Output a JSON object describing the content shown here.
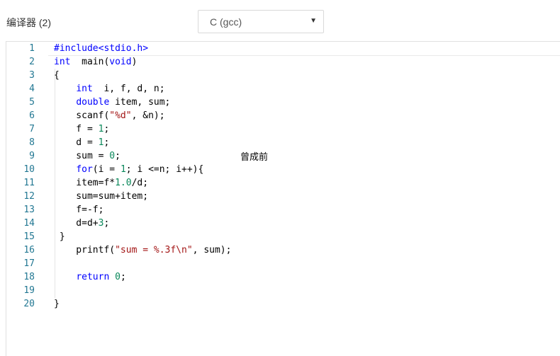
{
  "toolbar": {
    "compiler_label": "编译器 (2)",
    "language_select": {
      "value": "C (gcc)",
      "arrow": "▼"
    }
  },
  "editor": {
    "lines": [
      {
        "n": "1",
        "tokens": [
          [
            "kw",
            "#include<stdio.h>"
          ]
        ]
      },
      {
        "n": "2",
        "tokens": [
          [
            "kw",
            "int"
          ],
          [
            "",
            "  main("
          ],
          [
            "kw",
            "void"
          ],
          [
            "",
            ")"
          ]
        ]
      },
      {
        "n": "3",
        "tokens": [
          [
            "",
            "{"
          ]
        ]
      },
      {
        "n": "4",
        "tokens": [
          [
            "",
            "    "
          ],
          [
            "kw",
            "int"
          ],
          [
            "",
            "  i, f, d, n;"
          ]
        ]
      },
      {
        "n": "5",
        "tokens": [
          [
            "",
            "    "
          ],
          [
            "kw",
            "double"
          ],
          [
            "",
            " item, sum;"
          ]
        ]
      },
      {
        "n": "6",
        "tokens": [
          [
            "",
            "    scanf("
          ],
          [
            "str",
            "\"%d\""
          ],
          [
            "",
            ", &n);"
          ]
        ]
      },
      {
        "n": "7",
        "tokens": [
          [
            "",
            "    f = "
          ],
          [
            "num-lit",
            "1"
          ],
          [
            "",
            ";"
          ]
        ]
      },
      {
        "n": "8",
        "tokens": [
          [
            "",
            "    d = "
          ],
          [
            "num-lit",
            "1"
          ],
          [
            "",
            ";"
          ]
        ]
      },
      {
        "n": "9",
        "tokens": [
          [
            "",
            "    sum = "
          ],
          [
            "num-lit",
            "0"
          ],
          [
            "",
            ";"
          ]
        ]
      },
      {
        "n": "10",
        "tokens": [
          [
            "",
            "    "
          ],
          [
            "kw",
            "for"
          ],
          [
            "",
            "(i = "
          ],
          [
            "num-lit",
            "1"
          ],
          [
            "",
            "; i <=n; i++){"
          ]
        ]
      },
      {
        "n": "11",
        "tokens": [
          [
            "",
            "    item=f*"
          ],
          [
            "num-lit",
            "1.0"
          ],
          [
            "",
            "/d;"
          ]
        ]
      },
      {
        "n": "12",
        "tokens": [
          [
            "",
            "    sum=sum+item;"
          ]
        ]
      },
      {
        "n": "13",
        "tokens": [
          [
            "",
            "    f=-f;"
          ]
        ]
      },
      {
        "n": "14",
        "tokens": [
          [
            "",
            "    d=d+"
          ],
          [
            "num-lit",
            "3"
          ],
          [
            "",
            ";"
          ]
        ]
      },
      {
        "n": "15",
        "tokens": [
          [
            "",
            " }"
          ]
        ]
      },
      {
        "n": "16",
        "tokens": [
          [
            "",
            "    printf("
          ],
          [
            "str",
            "\"sum = %.3f\\n\""
          ],
          [
            "",
            ", sum);"
          ]
        ]
      },
      {
        "n": "17",
        "tokens": []
      },
      {
        "n": "18",
        "tokens": [
          [
            "",
            "    "
          ],
          [
            "kw",
            "return"
          ],
          [
            "",
            " "
          ],
          [
            "num-lit",
            "0"
          ],
          [
            "",
            ";"
          ]
        ]
      },
      {
        "n": "19",
        "tokens": []
      },
      {
        "n": "20",
        "tokens": [
          [
            "",
            "}"
          ]
        ]
      }
    ]
  },
  "overlay_note": "曾成前"
}
